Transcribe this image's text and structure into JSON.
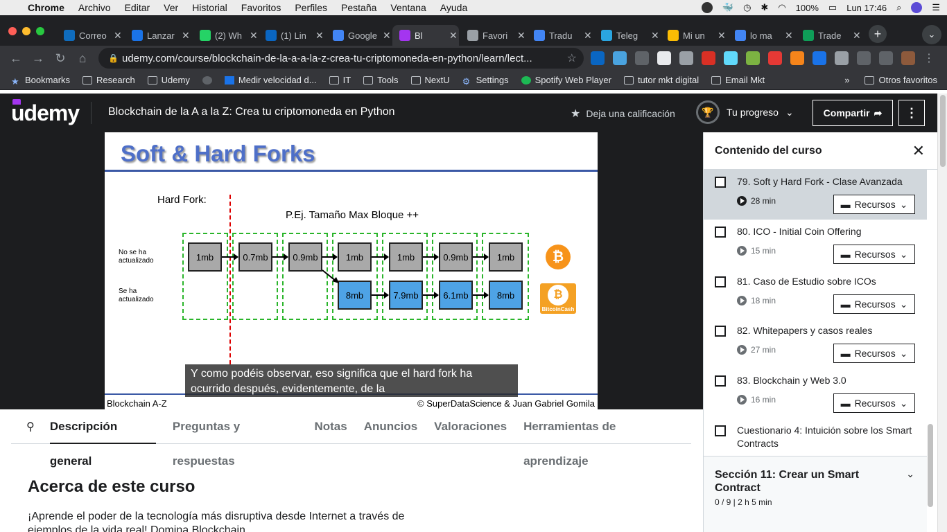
{
  "menubar": {
    "app": "Chrome",
    "items": [
      "Archivo",
      "Editar",
      "Ver",
      "Historial",
      "Favoritos",
      "Perfiles",
      "Pestaña",
      "Ventana",
      "Ayuda"
    ],
    "battery": "100%",
    "clock": "Lun 17:46"
  },
  "tabs": [
    {
      "title": "Correo",
      "color": "#0f6cbd"
    },
    {
      "title": "Lanzar",
      "color": "#1a73e8"
    },
    {
      "title": "(2) Wh",
      "color": "#25d366"
    },
    {
      "title": "(1) Lin",
      "color": "#0a66c2"
    },
    {
      "title": "Google",
      "color": "#4285f4"
    },
    {
      "title": "Bl",
      "color": "#a435f0"
    },
    {
      "title": "Favori",
      "color": "#9aa0a6"
    },
    {
      "title": "Tradu",
      "color": "#4285f4"
    },
    {
      "title": "Teleg",
      "color": "#2aa5e0"
    },
    {
      "title": "Mi un",
      "color": "#fbbc04"
    },
    {
      "title": "lo ma",
      "color": "#4285f4"
    },
    {
      "title": "Trade",
      "color": "#0f9d58"
    }
  ],
  "address": {
    "url": "udemy.com/course/blockchain-de-la-a-a-la-z-crea-tu-criptomoneda-en-python/learn/lect..."
  },
  "bookmarks": {
    "items": [
      "Bookmarks",
      "Research",
      "Udemy",
      "",
      "Medir velocidad d...",
      "IT",
      "Tools",
      "NextU",
      "Settings",
      "Spotify Web Player",
      "tutor mkt digital",
      "Email Mkt"
    ],
    "more": "»",
    "other": "Otros favoritos"
  },
  "udemy": {
    "logo": "udemy",
    "course_title": "Blockchain de la A a la Z: Crea tu criptomoneda en Python",
    "rate_label": "Deja una calificación",
    "progress_label": "Tu progreso",
    "share_label": "Compartir",
    "more_label": "⋮"
  },
  "slide": {
    "title": "Soft & Hard Forks",
    "hard_fork_label": "Hard Fork:",
    "example_label": "P.Ej. Tamaño Max Bloque ++",
    "not_updated_label": "No se ha actualizado",
    "updated_label": "Se ha actualizado",
    "top_chain": [
      "1mb",
      "0.7mb",
      "0.9mb",
      "1mb",
      "1mb",
      "0.9mb",
      "1mb"
    ],
    "bottom_chain": [
      "8mb",
      "7.9mb",
      "6.1mb",
      "8mb"
    ],
    "bitcoin_symbol": "₿",
    "bitcoin_cash_label": "BitcoinCash",
    "footer_left": "Blockchain A-Z",
    "footer_right": "© SuperDataScience & Juan Gabriel Gomila"
  },
  "caption": {
    "line1": "Y como podéis observar, eso significa que el hard fork ha",
    "line2": "ocurrido después, evidentemente, de la"
  },
  "content_tabs": {
    "search_icon": "⚲",
    "items": [
      "Descripción general",
      "Preguntas y respuestas",
      "Notas",
      "Anuncios",
      "Valoraciones",
      "Herramientas de aprendizaje"
    ],
    "active": 0
  },
  "about": {
    "title": "Acerca de este curso",
    "text": "¡Aprende el poder de la tecnología más disruptiva desde Internet a través de ejemplos de la vida real! Domina Blockchain"
  },
  "sidebar": {
    "title": "Contenido del curso",
    "close": "✕",
    "lessons": [
      {
        "title": "79. Soft y Hard Fork - Clase Avanzada",
        "duration": "28 min",
        "resources": "Recursos",
        "active": true
      },
      {
        "title": "80. ICO - Initial Coin Offering",
        "duration": "15 min",
        "resources": "Recursos"
      },
      {
        "title": "81. Caso de Estudio sobre ICOs",
        "duration": "18 min",
        "resources": "Recursos"
      },
      {
        "title": "82. Whitepapers y casos reales",
        "duration": "27 min",
        "resources": "Recursos"
      },
      {
        "title": "83. Blockchain y Web 3.0",
        "duration": "16 min",
        "resources": "Recursos"
      },
      {
        "title": "Cuestionario 4: Intuición sobre los Smart Contracts"
      }
    ],
    "section": {
      "title": "Sección 11: Crear un Smart Contract",
      "meta": "0 / 9 | 2 h 5 min"
    }
  },
  "colors": {
    "udemy_purple": "#a435f0",
    "header_bg": "#1c1d1f",
    "slide_title": "#4e6fc8",
    "block_gray": "#a9a9a9",
    "block_blue": "#4ea3e6",
    "fork_line": "#dd0000",
    "group_border": "#2bb52b",
    "bitcoin": "#f7931a"
  }
}
